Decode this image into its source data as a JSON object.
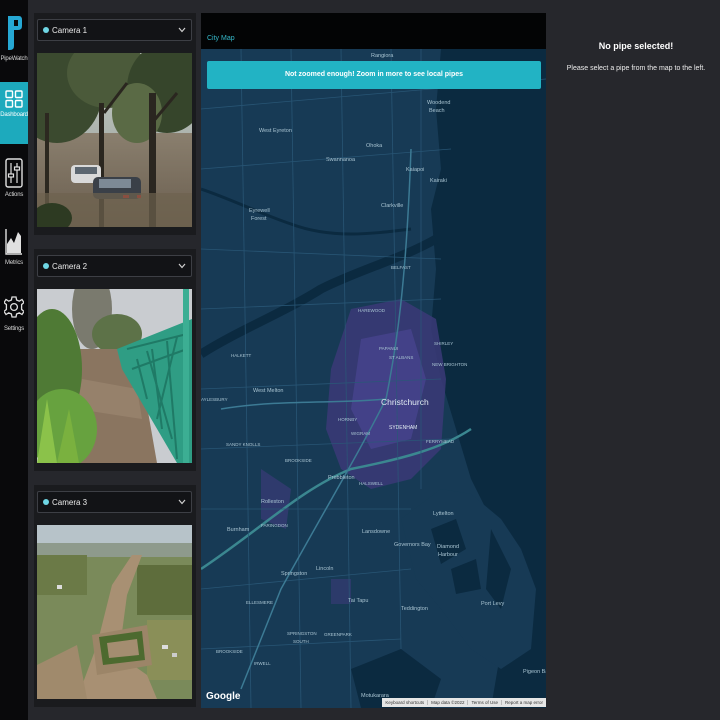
{
  "app": {
    "name": "PipeWatch"
  },
  "nav": {
    "items": [
      {
        "label": "Dashboard",
        "icon": "dashboard-grid-icon",
        "active": true
      },
      {
        "label": "Actions",
        "icon": "sliders-icon",
        "active": false
      },
      {
        "label": "Metrics",
        "icon": "area-chart-icon",
        "active": false
      },
      {
        "label": "Settings",
        "icon": "gear-icon",
        "active": false
      }
    ]
  },
  "cameras": [
    {
      "label": "Camera 1",
      "scene": "flooded street with submerged cars"
    },
    {
      "label": "Camera 2",
      "scene": "flooded river under steel truss bridge"
    },
    {
      "label": "Camera 3",
      "scene": "aerial view of flooded farmland"
    }
  ],
  "map": {
    "title": "City Map",
    "banner": "Not zoomed enough! Zoom in more to see local pipes",
    "google_mark": "Google",
    "footer": [
      "Keyboard shortcuts",
      "Map data ©2022",
      "Terms of Use",
      "Report a map error"
    ],
    "labels": [
      "Rangiora",
      "Woodend Beach",
      "West Eyreton",
      "Swannanoa",
      "Ohoka",
      "Kaiapoi",
      "Kairaki",
      "Eyrewell Forest",
      "Clarkville",
      "BELFAST",
      "HAREWOOD",
      "PAPANUI",
      "ST ALBANS",
      "SHIRLEY",
      "NEW BRIGHTON",
      "HALKETT",
      "West Melton",
      "AYLESBURY",
      "HORNBY",
      "Christchurch",
      "SYDENHAM",
      "WIGRAM",
      "FERRYMEAD",
      "SANDY KNOLLS",
      "BROOKSIDE",
      "Prebbleton",
      "HALSWELL",
      "Rolleston",
      "FARINGDON",
      "Burnham",
      "Lansdowne",
      "Governors Bay",
      "Lyttelton",
      "Diamond Harbour",
      "Springston",
      "Lincoln",
      "Tai Tapu",
      "Teddington",
      "Port Levy",
      "ELLESMERE",
      "SPRINGSTON SOUTH",
      "GREENPARK",
      "IRWELL",
      "BROOKSIDE",
      "Motukarara",
      "Pigeon Bay"
    ]
  },
  "detail": {
    "title": "No pipe selected!",
    "message": "Please select a pipe from the map to the left."
  },
  "colors": {
    "accent": "#1daabd",
    "banner": "#22b3c4",
    "background": "#26272c",
    "nav_background": "#09090b",
    "map_water": "#0f3b55",
    "map_land": "#173a55",
    "urban": "#3b3a78"
  }
}
